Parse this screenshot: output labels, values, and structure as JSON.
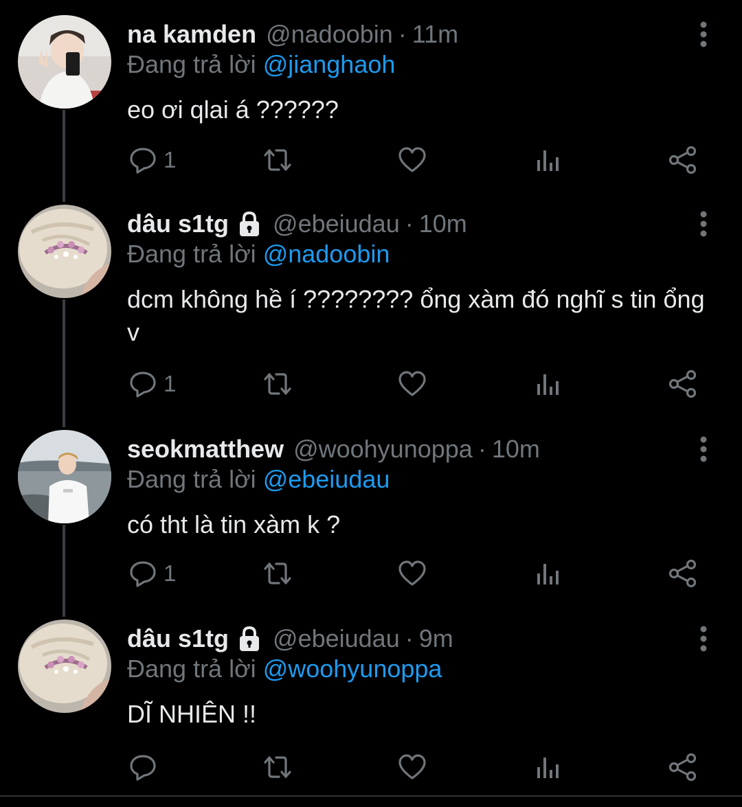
{
  "reply_prefix": "Đang trả lời",
  "colors": {
    "background": "#000000",
    "muted": "#71767b",
    "link": "#1d9bf0",
    "text": "#e7e9ea"
  },
  "tweets": [
    {
      "name": "na kamden",
      "handle": "@nadoobin",
      "time": "11m",
      "locked": false,
      "reply_to": "@jianghaoh",
      "text": "eo ơi qlai á ??????",
      "reply_count": "1",
      "avatar_icon": "selfie-avatar"
    },
    {
      "name": "dâu s1tg",
      "handle": "@ebeiudau",
      "time": "10m",
      "locked": true,
      "reply_to": "@nadoobin",
      "text": "dcm không hề í ???????? ổng xàm đó nghĩ s tin ổng v",
      "reply_count": "1",
      "avatar_icon": "hair-clip-avatar"
    },
    {
      "name": "seokmatthew",
      "handle": "@woohyunoppa",
      "time": "10m",
      "locked": false,
      "reply_to": "@ebeiudau",
      "text": "có tht là tin xàm k ?",
      "reply_count": "1",
      "avatar_icon": "beach-avatar"
    },
    {
      "name": "dâu s1tg",
      "handle": "@ebeiudau",
      "time": "9m",
      "locked": true,
      "reply_to": "@woohyunoppa",
      "text": "DĨ NHIÊN !!",
      "reply_count": "",
      "avatar_icon": "hair-clip-avatar"
    }
  ],
  "dot": "·"
}
